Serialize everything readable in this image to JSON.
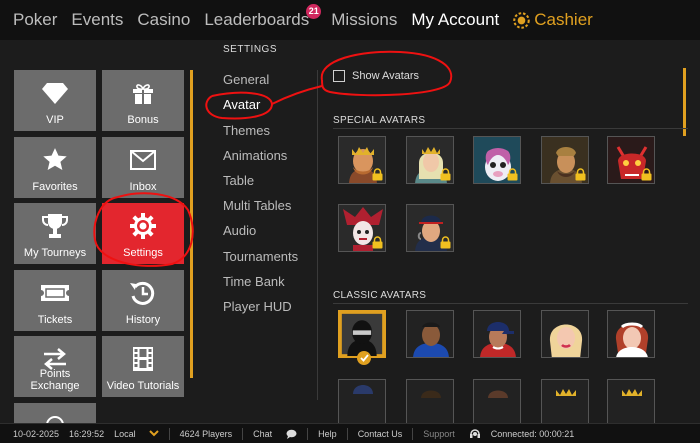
{
  "nav": {
    "items": [
      {
        "label": "Poker"
      },
      {
        "label": "Events"
      },
      {
        "label": "Casino"
      },
      {
        "label": "Leaderboards",
        "badge": "21"
      },
      {
        "label": "Missions"
      },
      {
        "label": "My Account"
      }
    ],
    "cashier": "Cashier",
    "accent": "#e0a020"
  },
  "tiles": [
    {
      "label": "VIP",
      "icon": "diamond-icon"
    },
    {
      "label": "Bonus",
      "icon": "gift-icon"
    },
    {
      "label": "Favorites",
      "icon": "star-icon"
    },
    {
      "label": "Inbox",
      "icon": "envelope-icon"
    },
    {
      "label": "My Tourneys",
      "icon": "trophy-icon"
    },
    {
      "label": "Settings",
      "icon": "gear-icon"
    },
    {
      "label": "Tickets",
      "icon": "ticket-icon"
    },
    {
      "label": "History",
      "icon": "history-icon"
    },
    {
      "label": "Points Exchange",
      "icon": "exchange-arrows-icon"
    },
    {
      "label": "Video Tutorials",
      "icon": "film-icon"
    }
  ],
  "settings": {
    "title": "SETTINGS",
    "menu": [
      "General",
      "Avatar",
      "Themes",
      "Animations",
      "Table",
      "Multi Tables",
      "Audio",
      "Tournaments",
      "Time Bank",
      "Player HUD"
    ],
    "selected": "Avatar"
  },
  "content": {
    "show_avatars": "Show Avatars",
    "special_title": "SPECIAL AVATARS",
    "classic_title": "CLASSIC AVATARS"
  },
  "status": {
    "date": "10-02-2025",
    "time": "16:29:52",
    "timezone": "Local",
    "players": "4624 Players",
    "chat": "Chat",
    "help": "Help",
    "contact": "Contact Us",
    "support": "Support",
    "connected": "Connected: 00:00:21"
  }
}
